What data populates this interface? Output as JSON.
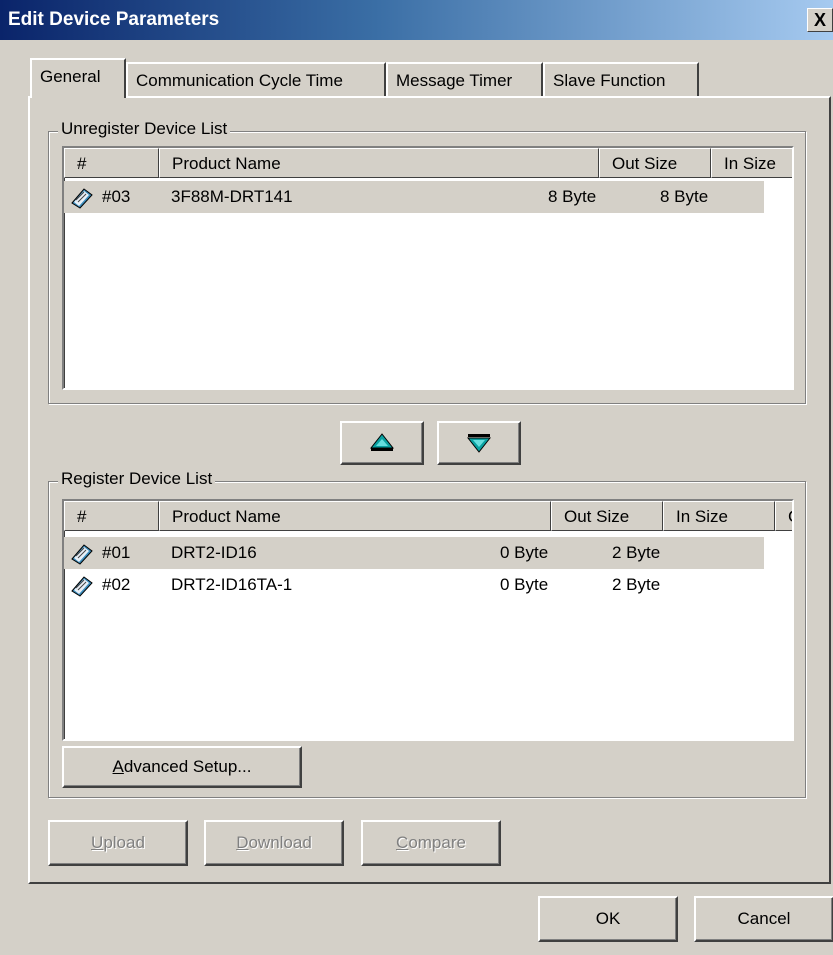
{
  "window": {
    "title": "Edit Device Parameters",
    "close_label": "X"
  },
  "tabs": [
    {
      "label": "General",
      "active": true
    },
    {
      "label": "Communication Cycle Time"
    },
    {
      "label": "Message Timer"
    },
    {
      "label": "Slave Function"
    }
  ],
  "unregister": {
    "group_label": "Unregister Device List",
    "columns": [
      "#",
      "Product Name",
      "Out Size",
      "In Size",
      ""
    ],
    "rows": [
      {
        "num": "#03",
        "product": "3F88M-DRT141",
        "out": "8 Byte",
        "in": "8 Byte",
        "c": "",
        "icon": "device-icon"
      }
    ]
  },
  "register": {
    "group_label": "Register Device List",
    "columns": [
      "#",
      "Product Name",
      "Out Size",
      "In Size",
      "C",
      ""
    ],
    "rows": [
      {
        "num": "#01",
        "product": "DRT2-ID16",
        "out": "0 Byte",
        "in": "2 Byte",
        "c": "",
        "icon": "device-icon"
      },
      {
        "num": "#02",
        "product": "DRT2-ID16TA-1",
        "out": "0 Byte",
        "in": "2 Byte",
        "c": "",
        "icon": "device-icon"
      }
    ]
  },
  "move_buttons": {
    "up_icon": "move-up-icon",
    "down_icon": "move-down-icon"
  },
  "advanced_button": {
    "prefix": "A",
    "rest": "dvanced Setup..."
  },
  "action_buttons": [
    {
      "prefix": "U",
      "rest": "pload"
    },
    {
      "prefix": "D",
      "rest": "ownload"
    },
    {
      "prefix": "C",
      "rest": "ompare"
    }
  ],
  "dialog_buttons": {
    "ok": "OK",
    "cancel": "Cancel"
  }
}
